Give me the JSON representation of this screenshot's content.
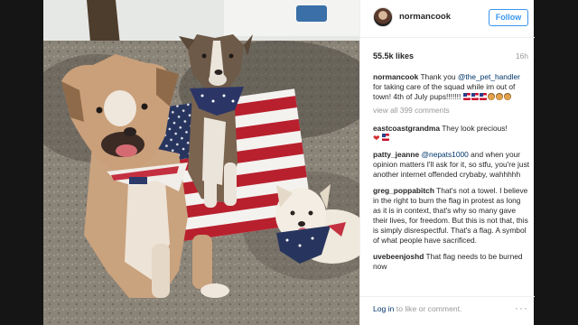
{
  "post": {
    "username": "normancook",
    "follow_label": "Follow",
    "likes": "55.5k likes",
    "age": "16h"
  },
  "caption": {
    "author": "normancook",
    "text_1": " Thank you ",
    "mention": "@the_pet_handler",
    "text_2": " for taking care of the squad while im out of town! 4th of July pups!!!!!!!"
  },
  "view_all": "view all 399 comments",
  "comments": [
    {
      "author": "eastcoastgrandma",
      "text": " They look precious!"
    },
    {
      "author": "patty_jeanne",
      "mention": "@nepats1000",
      "text": " and when your opinion matters I'll ask for it, so stfu, you're just another internet offended crybaby, wahhhhh"
    },
    {
      "author": "greg_poppabitch",
      "text": " That's not a towel. I believe in the right to burn the flag in protest as long as it is in context, that's why so many gave their lives, for freedom. But this is not that, this is simply disrespectful. That's a flag. A symbol of what people have sacrificed."
    },
    {
      "author": "uvebeenjoshd",
      "text": " That flag needs to be burned now"
    }
  ],
  "footer": {
    "login_link": "Log in",
    "login_rest": " to like or comment.",
    "more": "···"
  },
  "icons": {
    "avatar": "avatar",
    "more": "more-options-icon",
    "heart": "heart-emoji",
    "flag": "us-flag-emoji",
    "dog": "dog-emoji"
  },
  "colors": {
    "accent_blue": "#3897f0",
    "link_blue": "#003569",
    "muted": "#999999",
    "text": "#262626"
  }
}
